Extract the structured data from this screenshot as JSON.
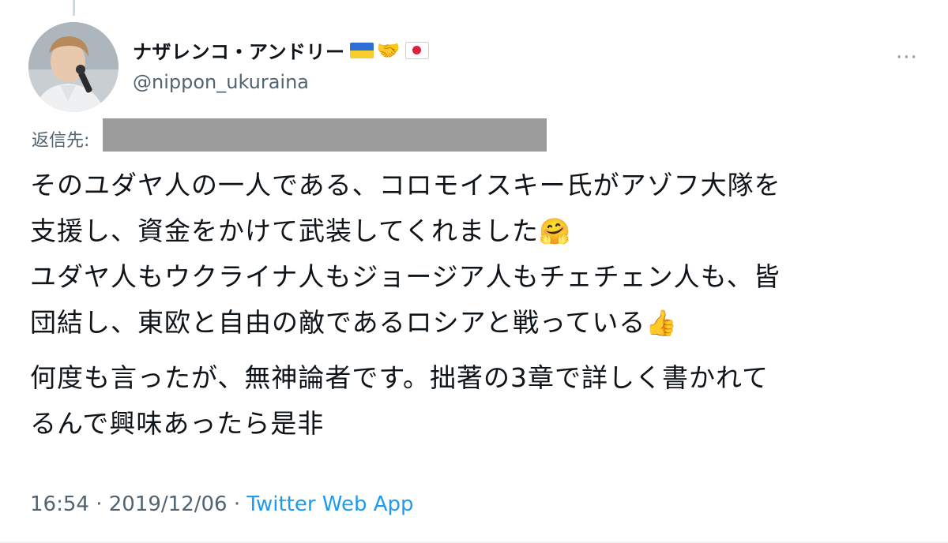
{
  "tweet": {
    "display_name": "ナザレンコ・アンドリー",
    "handshake_emoji": "🤝",
    "handle": "@nippon_ukuraina",
    "more_icon": "···",
    "reply_to_label": "返信先:",
    "body_lines": [
      "そのユダヤ人の一人である、コロモイスキー氏がアゾフ大隊を",
      "支援し、資金をかけて武装してくれました",
      "ユダヤ人もウクライナ人もジョージア人もチェチェン人も、皆",
      "団結し、東欧と自由の敵であるロシアと戦っている",
      "何度も言ったが、無神論者です。拙著の3章で詳しく書かれて",
      "るんで興味あったら是非"
    ],
    "emoji_hug": "🤗",
    "emoji_thumbs": "👍",
    "time": "16:54",
    "separator": " · ",
    "date": "2019/12/06",
    "source": "Twitter Web App"
  },
  "colors": {
    "text": "#0f1419",
    "secondary": "#536471",
    "link": "#1d9bf0",
    "redaction": "#9b9b9b"
  },
  "icons": [
    "avatar",
    "ukraine-flag-icon",
    "handshake-icon",
    "japan-flag-icon",
    "more-icon",
    "hug-emoji-icon",
    "thumbs-up-emoji-icon"
  ]
}
